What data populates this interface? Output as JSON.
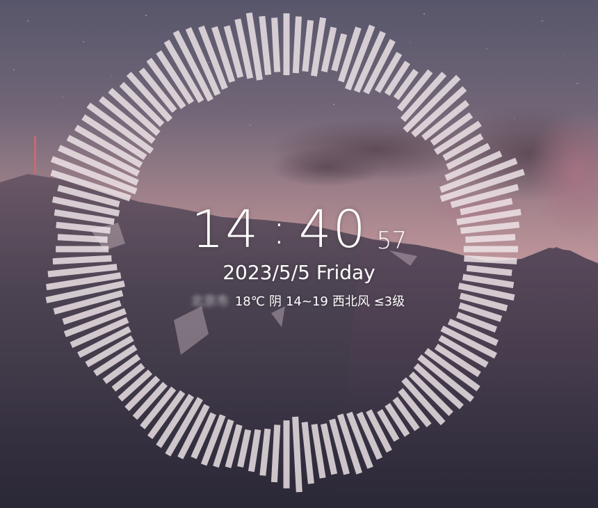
{
  "clock": {
    "hours": "14",
    "separator": ":",
    "minutes": "40",
    "seconds": "57"
  },
  "date": {
    "text": "2023/5/5 Friday"
  },
  "weather": {
    "city": "北京市",
    "temperature": "18℃",
    "condition": "阴",
    "range": "14~19",
    "wind": "西北风 ≤3级"
  },
  "visualizer": {
    "bar_color": "#f0e6ea",
    "levels": [
      0.62,
      0.55,
      0.48,
      0.58,
      0.4,
      0.3,
      0.55,
      0.7,
      0.66,
      0.58,
      0.38,
      0.3,
      0.25,
      0.45,
      0.62,
      0.8,
      0.72,
      0.55,
      0.44,
      0.5,
      0.38,
      0.42,
      0.6,
      0.88,
      0.96,
      0.72,
      0.5,
      0.66,
      0.58,
      0.46,
      0.52,
      0.5,
      0.4,
      0.48,
      0.55,
      0.44,
      0.38,
      0.35,
      0.5,
      0.6,
      0.52,
      0.48,
      0.66,
      0.7,
      0.62,
      0.55,
      0.58,
      0.4,
      0.3,
      0.28,
      0.25,
      0.4,
      0.46,
      0.58,
      0.62,
      0.55,
      0.48,
      0.52,
      0.62,
      0.8,
      0.7,
      0.56,
      0.42,
      0.36,
      0.3,
      0.38,
      0.45,
      0.5,
      0.44,
      0.58,
      0.66,
      0.6,
      0.54,
      0.46,
      0.4,
      0.38,
      0.34,
      0.3,
      0.36,
      0.44,
      0.5,
      0.56,
      0.62,
      0.66,
      0.6,
      0.74,
      0.86,
      0.8,
      0.72,
      0.58,
      0.5,
      0.46,
      0.52,
      0.6,
      0.7,
      0.64,
      0.9,
      1.0,
      0.94,
      0.85,
      0.8,
      0.78,
      0.84,
      0.7,
      0.66,
      0.56,
      0.62,
      0.5,
      0.58,
      0.6,
      0.72,
      0.82,
      0.76,
      0.68,
      0.56,
      0.5,
      0.6,
      0.7,
      0.58,
      0.52
    ]
  }
}
